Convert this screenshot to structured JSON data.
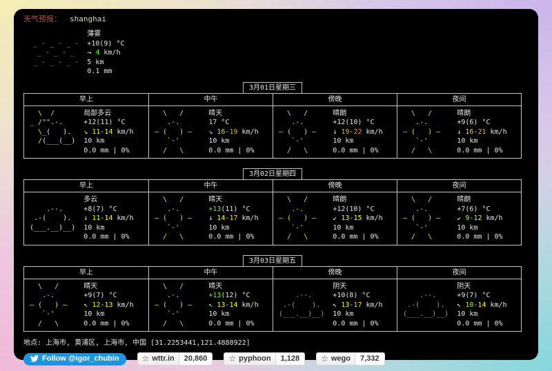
{
  "palette": {
    "sun": "#e9e141",
    "cloud": "#e6e6e6",
    "gray": "#9e9e9e",
    "fg": "#e4e4e4",
    "green": "#5fff00",
    "lime": "#afff00",
    "yellowgreen": "#d7ff00",
    "yellow": "#ffff00",
    "gold": "#ffd700",
    "orange": "#ffaf00",
    "deeporange": "#ff8700",
    "accent_twitter": "#1b95e0"
  },
  "header": {
    "label": "天气预报：",
    "location": "shanghai"
  },
  "current": {
    "condition": "薄雾",
    "icon": "fog",
    "temp": [
      {
        "t": "+10(9)",
        "c": ""
      }
    ],
    "wind": {
      "arrow": "→",
      "parts": [
        {
          "t": "4",
          "c": "green"
        }
      ]
    },
    "visibility": "5 km",
    "precip": "0.1 mm"
  },
  "columns": [
    "早上",
    "中午",
    "傍晚",
    "夜间"
  ],
  "days": [
    {
      "title": "3月01日星期三",
      "cells": [
        {
          "condition": "局部多云",
          "icon": "partly_cloudy",
          "temp": [
            {
              "t": "+12(11)",
              "c": ""
            }
          ],
          "wind": {
            "arrow": "↘",
            "parts": [
              {
                "t": "11",
                "c": "yellowgreen"
              },
              {
                "t": "-",
                "c": ""
              },
              {
                "t": "14",
                "c": "yellow"
              }
            ]
          },
          "visibility": "10 km",
          "precip": "0.0 mm | 0%"
        },
        {
          "condition": "晴天",
          "icon": "sunny",
          "temp": [
            {
              "t": "17",
              "c": "yellowgreen"
            }
          ],
          "wind": {
            "arrow": "↘",
            "parts": [
              {
                "t": "16",
                "c": "gold"
              },
              {
                "t": "-",
                "c": ""
              },
              {
                "t": "19",
                "c": "orange"
              }
            ]
          },
          "visibility": "10 km",
          "precip": "0.0 mm | 0%"
        },
        {
          "condition": "晴朗",
          "icon": "sunny",
          "temp": [
            {
              "t": "+12(10)",
              "c": ""
            }
          ],
          "wind": {
            "arrow": "↓",
            "parts": [
              {
                "t": "19",
                "c": "orange"
              },
              {
                "t": "-",
                "c": ""
              },
              {
                "t": "22",
                "c": "deeporange"
              }
            ]
          },
          "visibility": "10 km",
          "precip": "0.0 mm | 0%"
        },
        {
          "condition": "晴朗",
          "icon": "sunny",
          "temp": [
            {
              "t": "+9(6)",
              "c": ""
            }
          ],
          "wind": {
            "arrow": "↓",
            "parts": [
              {
                "t": "16",
                "c": "gold"
              },
              {
                "t": "-",
                "c": ""
              },
              {
                "t": "21",
                "c": "orange"
              }
            ]
          },
          "visibility": "10 km",
          "precip": "0.0 mm | 0%"
        }
      ]
    },
    {
      "title": "3月02日星期四",
      "cells": [
        {
          "condition": "多云",
          "icon": "cloudy",
          "temp": [
            {
              "t": "+8(7)",
              "c": ""
            }
          ],
          "wind": {
            "arrow": "↓",
            "parts": [
              {
                "t": "11",
                "c": "yellowgreen"
              },
              {
                "t": "-",
                "c": ""
              },
              {
                "t": "14",
                "c": "yellow"
              }
            ]
          },
          "visibility": "10 km",
          "precip": "0.0 mm | 0%"
        },
        {
          "condition": "晴天",
          "icon": "sunny",
          "temp": [
            {
              "t": "+13",
              "c": "green"
            },
            {
              "t": "(11)",
              "c": ""
            }
          ],
          "wind": {
            "arrow": "↓",
            "parts": [
              {
                "t": "14",
                "c": "yellow"
              },
              {
                "t": "-",
                "c": ""
              },
              {
                "t": "17",
                "c": "gold"
              }
            ]
          },
          "visibility": "10 km",
          "precip": "0.0 mm | 0%"
        },
        {
          "condition": "晴朗",
          "icon": "sunny",
          "temp": [
            {
              "t": "+12(10)",
              "c": ""
            }
          ],
          "wind": {
            "arrow": "↙",
            "parts": [
              {
                "t": "13",
                "c": "yellow"
              },
              {
                "t": "-",
                "c": ""
              },
              {
                "t": "15",
                "c": "yellow"
              }
            ]
          },
          "visibility": "10 km",
          "precip": "0.0 mm | 0%"
        },
        {
          "condition": "晴朗",
          "icon": "sunny",
          "temp": [
            {
              "t": "+7(6)",
              "c": ""
            }
          ],
          "wind": {
            "arrow": "↙",
            "parts": [
              {
                "t": "9",
                "c": "lime"
              },
              {
                "t": "-",
                "c": ""
              },
              {
                "t": "12",
                "c": "yellowgreen"
              }
            ]
          },
          "visibility": "10 km",
          "precip": "0.0 mm | 0%"
        }
      ]
    },
    {
      "title": "3月03日星期五",
      "cells": [
        {
          "condition": "晴天",
          "icon": "sunny",
          "temp": [
            {
              "t": "+9(7)",
              "c": ""
            }
          ],
          "wind": {
            "arrow": "↖",
            "parts": [
              {
                "t": "12",
                "c": "yellowgreen"
              },
              {
                "t": "-",
                "c": ""
              },
              {
                "t": "13",
                "c": "yellow"
              }
            ]
          },
          "visibility": "10 km",
          "precip": "0.0 mm | 0%"
        },
        {
          "condition": "晴天",
          "icon": "sunny",
          "temp": [
            {
              "t": "+13",
              "c": "green"
            },
            {
              "t": "(12)",
              "c": ""
            }
          ],
          "wind": {
            "arrow": "↖",
            "parts": [
              {
                "t": "13",
                "c": "yellow"
              },
              {
                "t": "-",
                "c": ""
              },
              {
                "t": "14",
                "c": "yellow"
              }
            ]
          },
          "visibility": "10 km",
          "precip": "0.0 mm | 0%"
        },
        {
          "condition": "阴天",
          "icon": "overcast",
          "temp": [
            {
              "t": "+10(8)",
              "c": ""
            }
          ],
          "wind": {
            "arrow": "↖",
            "parts": [
              {
                "t": "13",
                "c": "yellow"
              },
              {
                "t": "-",
                "c": ""
              },
              {
                "t": "17",
                "c": "gold"
              }
            ]
          },
          "visibility": "10 km",
          "precip": "0.0 mm | 0%"
        },
        {
          "condition": "阴天",
          "icon": "overcast",
          "temp": [
            {
              "t": "+9(7)",
              "c": ""
            }
          ],
          "wind": {
            "arrow": "↖",
            "parts": [
              {
                "t": "10",
                "c": "lime"
              },
              {
                "t": "-",
                "c": ""
              },
              {
                "t": "14",
                "c": "yellow"
              }
            ]
          },
          "visibility": "10 km",
          "precip": "0.0 mm | 0%"
        }
      ]
    }
  ],
  "footer": {
    "location": "地点: 上海市, 黄浦区, 上海市, 中国 [31.2253441,121.4888922]"
  },
  "social": {
    "twitter": {
      "label": "Follow @igor_chubin"
    },
    "github": [
      {
        "name": "wttr.in",
        "count": "20,860"
      },
      {
        "name": "pyphoon",
        "count": "1,128"
      },
      {
        "name": "wego",
        "count": "7,332"
      }
    ]
  },
  "units": {
    "temp": " °C",
    "wind": " km/h"
  },
  "icons": {
    "sunny": [
      [
        [
          "   \\   /",
          "sun"
        ]
      ],
      [
        [
          "    .-.",
          "sun"
        ]
      ],
      [
        [
          " ― (   ) ―",
          "sun"
        ]
      ],
      [
        [
          "    `-'",
          "sun"
        ]
      ],
      [
        [
          "   /   \\",
          "sun"
        ]
      ]
    ],
    "partly_cloudy": [
      [
        [
          "   \\  /",
          "sun"
        ]
      ],
      [
        [
          " _ /\"\"",
          "sun"
        ],
        [
          ".-.",
          "cloud"
        ]
      ],
      [
        [
          "   \\_",
          "sun"
        ],
        [
          "(   ).",
          "cloud"
        ]
      ],
      [
        [
          "   /",
          "sun"
        ],
        [
          "(___(__)",
          "cloud"
        ]
      ],
      []
    ],
    "cloudy": [
      [],
      [
        [
          "     .--.",
          "cloud"
        ]
      ],
      [
        [
          "  .-(    ).",
          "cloud"
        ]
      ],
      [
        [
          " (___.__)__)",
          "cloud"
        ]
      ],
      []
    ],
    "overcast": [
      [],
      [
        [
          "     .--.",
          "gray"
        ]
      ],
      [
        [
          "  .-(    ).",
          "gray"
        ]
      ],
      [
        [
          " (___.__)__)",
          "gray"
        ]
      ],
      []
    ],
    "fog": [
      [],
      [
        [
          " _ - _ - _ -",
          "gray"
        ]
      ],
      [
        [
          "  _ - _ - _",
          "gray"
        ]
      ],
      [
        [
          " _ - _ - _ -",
          "gray"
        ]
      ],
      []
    ]
  }
}
